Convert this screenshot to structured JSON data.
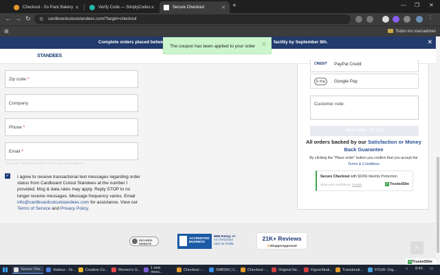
{
  "browser": {
    "tabs": [
      {
        "title": "Checkout - So Pack Bakery",
        "fav_color": "#e39a2a",
        "active": false
      },
      {
        "title": "Verify Code — SimplyCodes",
        "fav_color": "#22b8a8",
        "active": false
      },
      {
        "title": "Secure Checkout",
        "fav_color": "#ffffff",
        "active": true
      }
    ],
    "new_tab": "+",
    "url": "cardboardcutoutstandees.com/?target=checkout",
    "bookmarks_folder": "Todos los marcadores"
  },
  "banner": {
    "text_left": "Complete orders placed betwe",
    "text_right": "facility by September 8th."
  },
  "toast": {
    "message": "The coupon has been applied to your order"
  },
  "header": {
    "logo": "STANDEES"
  },
  "form": {
    "fields": [
      {
        "label": "Zip code",
        "required": "*"
      },
      {
        "label": "Company",
        "required": ""
      },
      {
        "label": "Phone",
        "required": "*"
      },
      {
        "label": "Email",
        "required": "*"
      }
    ],
    "email_hint": "Your order confirmation will be sent to your email address",
    "consent": {
      "text1": "I agree to receive transactional text messages regarding order status from Cardboard Cutout Standees at the number I provided. Msg & data rates may apply. Reply STOP to no longer receive messages. Message frequency varies. Email ",
      "email": "info@cardboardcutoutstandees.com",
      "text2": " for assistance. View our ",
      "tos": "Terms of Service",
      "and": " and ",
      "privacy": "Privacy Policy",
      "end": "."
    }
  },
  "payment": {
    "options": [
      {
        "icon_text": "CREDIT",
        "label": "PayPal Credit"
      },
      {
        "icon_text": "G Pay",
        "label": "Google Pay"
      }
    ],
    "customer_note_placeholder": "Customer note:",
    "place_order_label": "Place order - $72.50",
    "backed_text": "All orders backed by our ",
    "backed_link": "Satisfaction or Money Back Guarantee",
    "terms_text": "By clicking the \"Place order\" button you confirm that you accept the ",
    "terms_link": "Terms & Conditions",
    "secure_title_bold": "Secure Checkout",
    "secure_title_rest": " with $100k Identity Protection",
    "shop_text": "Shop with confidence. ",
    "details_link": "Details",
    "trustedsite": "TrustedSite"
  },
  "footer": {
    "secured_badge": "SECURED WEBSITE",
    "bbb_seal": "ACCREDITED BUSINESS",
    "bbb_rating": "BBB Rating: A+",
    "bbb_date": "As of 9/1/2023",
    "bbb_link": "Click for Profile",
    "reviews_count": "21K+ Reviews",
    "reviews_source": "ShopperApproved",
    "trustedsite_badge": "TrustedSite"
  },
  "taskbar": {
    "items": [
      {
        "label": "Secure Che...",
        "color": "#e0e0e0",
        "active": true
      },
      {
        "label": "Vedeus - Or...",
        "color": "#4a7bd8",
        "active": false
      },
      {
        "label": "Creative Co...",
        "color": "#f0b429",
        "active": false
      },
      {
        "label": "Women's G...",
        "color": "#e84a4a",
        "active": false
      },
      {
        "label": "1 new mess...",
        "color": "#7b5cd6",
        "active": false
      },
      {
        "label": "Checkout -...",
        "color": "#e39a2a",
        "active": false
      },
      {
        "label": "SMBSM | C...",
        "color": "#3a8ee6",
        "active": false
      },
      {
        "label": "Checkout -...",
        "color": "#e39a2a",
        "active": false
      },
      {
        "label": "Original Ne...",
        "color": "#d04040",
        "active": false
      },
      {
        "label": "FigureSkati...",
        "color": "#d04040",
        "active": false
      },
      {
        "label": "Transbouti...",
        "color": "#e39a2a",
        "active": false
      },
      {
        "label": "FOUR: Org...",
        "color": "#4aa0e0",
        "active": false
      }
    ],
    "clock": "8:40"
  }
}
